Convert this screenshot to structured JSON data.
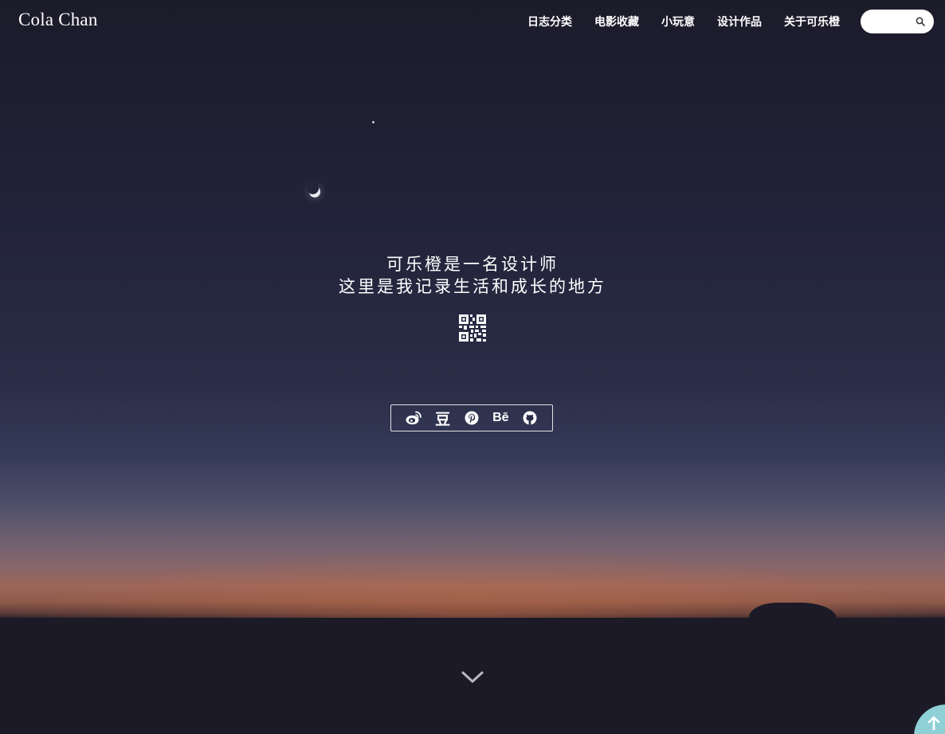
{
  "brand": {
    "name": "Cola Chan"
  },
  "nav": {
    "items": [
      {
        "label": "日志分类"
      },
      {
        "label": "电影收藏"
      },
      {
        "label": "小玩意"
      },
      {
        "label": "设计作品"
      },
      {
        "label": "关于可乐橙"
      }
    ]
  },
  "search": {
    "placeholder": "",
    "value": "",
    "icon": "search-icon"
  },
  "hero": {
    "line1": "可乐橙是一名设计师",
    "line2": "这里是我记录生活和成长的地方"
  },
  "qr": {
    "icon": "qr-code-icon"
  },
  "social": {
    "items": [
      {
        "name": "weibo",
        "icon": "weibo-icon"
      },
      {
        "name": "douban",
        "icon": "douban-icon",
        "glyph": "豆"
      },
      {
        "name": "pinterest",
        "icon": "pinterest-icon"
      },
      {
        "name": "behance",
        "icon": "behance-icon",
        "glyph": "Bē"
      },
      {
        "name": "github",
        "icon": "github-icon"
      }
    ]
  },
  "scroll": {
    "icon": "chevron-down-icon"
  },
  "back_to_top": {
    "icon": "arrow-up-icon"
  },
  "colors": {
    "sky_top": "#1c1b2a",
    "horizon": "#9c6659",
    "back_to_top": "#8fd0d6",
    "text": "#ffffff"
  }
}
